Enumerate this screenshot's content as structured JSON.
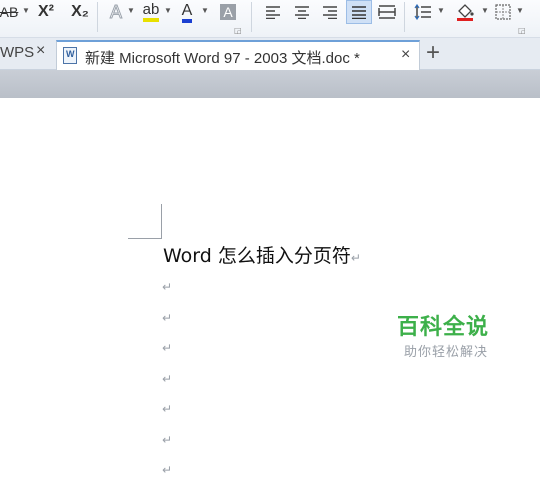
{
  "ribbon": {
    "strikethrough_label": "AB",
    "superscript_label": "X²",
    "subscript_label": "X₂",
    "text_effect_label": "A",
    "highlight_label": "ab",
    "font_color_label": "A",
    "char_shading_label": "A",
    "colors": {
      "font_color": "#1b3fd1",
      "highlight": "#e8e000",
      "fill": "#e02020",
      "selected_bg": "#cfe0f6"
    }
  },
  "tabs": {
    "wps_label": "WPS",
    "close_glyph": "×",
    "document_title": "新建 Microsoft Word 97 - 2003 文档.doc *",
    "document_icon": "W",
    "add_glyph": "+"
  },
  "document": {
    "heading": "Word 怎么插入分页符",
    "paragraph_mark": "↵",
    "empty_lines": [
      "↵",
      "↵",
      "↵",
      "↵",
      "↵",
      "↵",
      "↵"
    ]
  },
  "watermark": {
    "title": "百科全说",
    "subtitle": "助你轻松解决"
  }
}
